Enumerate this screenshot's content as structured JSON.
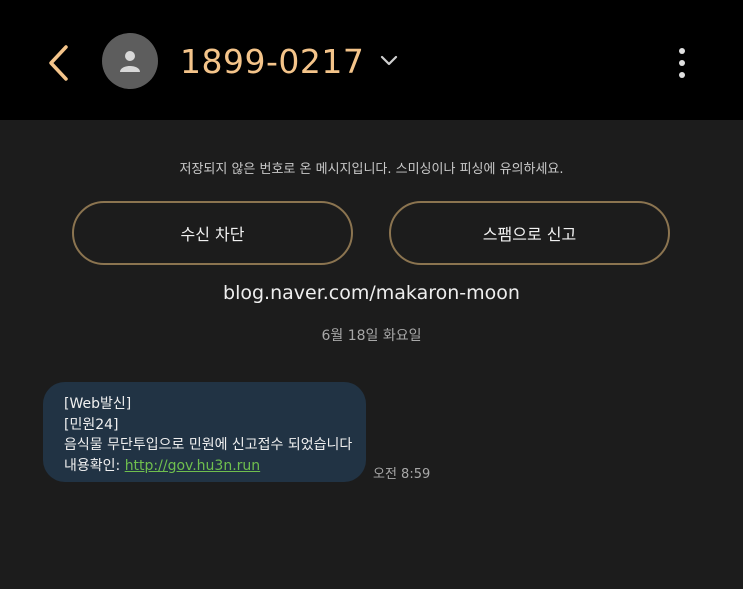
{
  "header": {
    "contact_number": "1899-0217",
    "back_icon": "chevron-left-icon",
    "avatar_icon": "person-icon",
    "dropdown_icon": "chevron-down-icon",
    "more_icon": "more-vertical-icon",
    "accent_color": "#f4c48a"
  },
  "notice": {
    "text": "저장되지 않은 번호로 온 메시지입니다. 스미싱이나 피싱에 유의하세요."
  },
  "actions": {
    "block_label": "수신 차단",
    "spam_label": "스팸으로 신고"
  },
  "sender_link": "blog.naver.com/makaron-moon",
  "date_separator": "6월 18일 화요일",
  "message": {
    "line1": "[Web발신]",
    "line2": "[민원24]",
    "line3": "음식물 무단투입으로 민원에 신고접수 되었습니다",
    "line4_prefix": "내용확인: ",
    "link": "http://gov.hu3n.run",
    "time": "오전 8:59",
    "bubble_color": "#213344",
    "link_color": "#6fbf4e"
  }
}
